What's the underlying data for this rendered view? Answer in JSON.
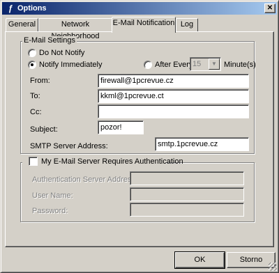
{
  "window": {
    "title": "Options",
    "close_glyph": "✕",
    "app_glyph": "ƒ"
  },
  "tabs": [
    {
      "label": "General"
    },
    {
      "label": "Network Neighborhood"
    },
    {
      "label": "E-Mail Notification",
      "active": true
    },
    {
      "label": "Log"
    }
  ],
  "email_settings": {
    "group_title": "E-Mail Settings",
    "do_not_notify_label": "Do Not Notify",
    "notify_immediately_label": "Notify Immediately",
    "after_every_label": "After Every",
    "interval_value": "15",
    "interval_unit": "Minute(s)",
    "selected_option": "notify_immediately",
    "from_label": "From:",
    "from_value": "firewall@1pcrevue.cz",
    "to_label": "To:",
    "to_value": "kkml@1pcrevue.ct",
    "cc_label": "Cc:",
    "cc_value": "",
    "subject_label": "Subject:",
    "subject_value": "pozor!",
    "smtp_label": "SMTP Server Address:",
    "smtp_value": "smtp.1pcrevue.cz"
  },
  "authentication": {
    "checkbox_label": "My E-Mail Server Requires Authentication",
    "checked": false,
    "server_label": "Authentication Server Address:",
    "server_value": "",
    "username_label": "User Name:",
    "username_value": "",
    "password_label": "Password:",
    "password_value": ""
  },
  "buttons": {
    "ok_label": "OK",
    "cancel_label": "Storno"
  },
  "colors": {
    "titlebar_start": "#0a246a",
    "titlebar_end": "#a6caf0",
    "face": "#d4d0c8"
  }
}
